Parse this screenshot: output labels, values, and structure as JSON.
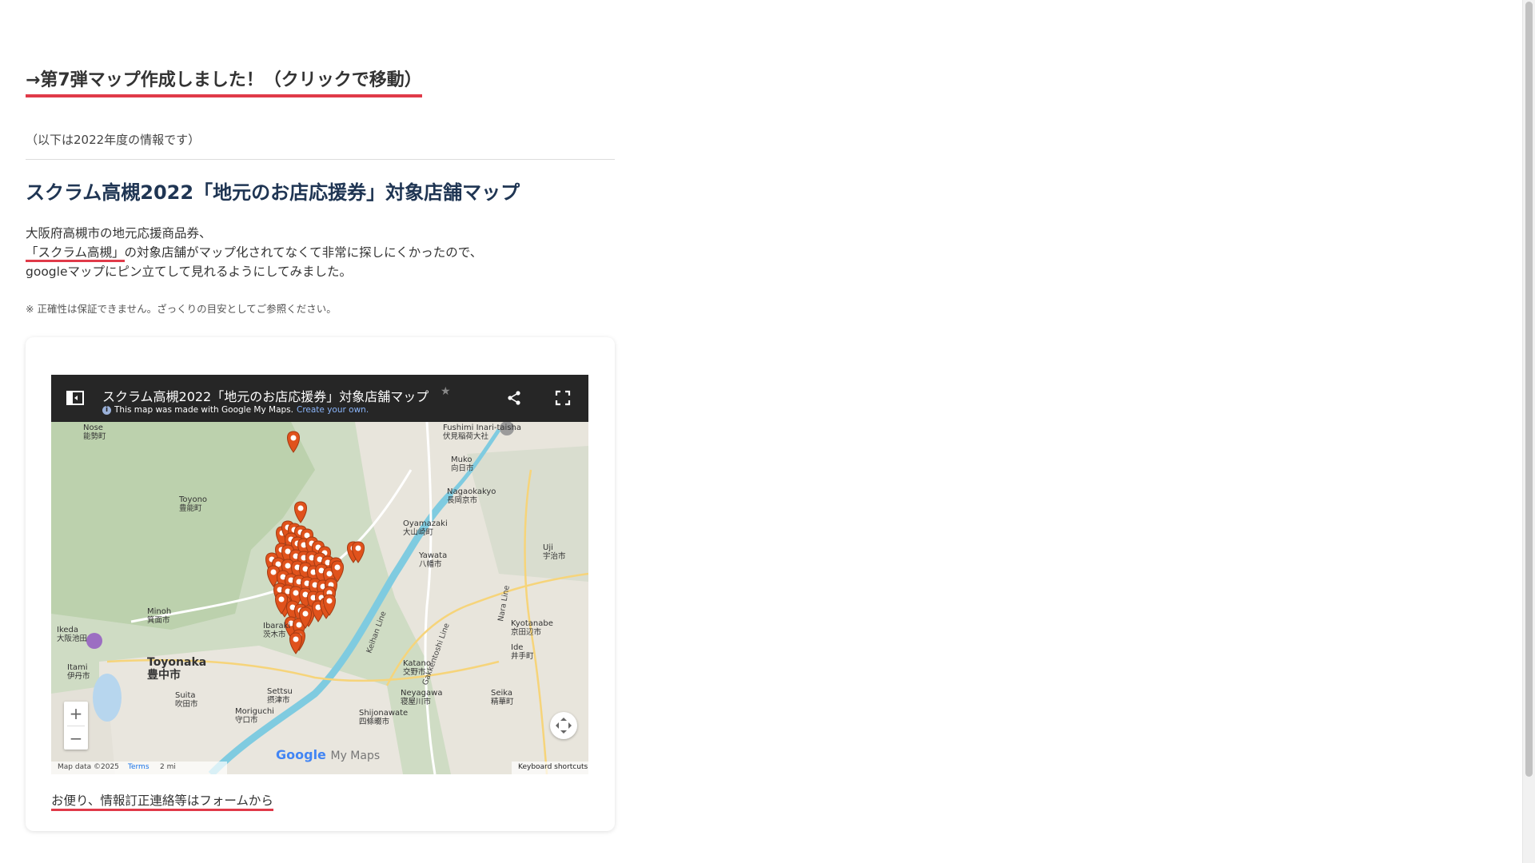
{
  "top_link": "→第7弾マップ作成しました！（クリックで移動）",
  "note_year": "（以下は2022年度の情報です）",
  "page_title": "スクラム高槻2022「地元のお店応援券」対象店舗マップ",
  "description": {
    "line1": "大阪府高槻市の地元応援商品券、",
    "line2_link": "「スクラム高槻」",
    "line2_rest": "の対象店舗がマップ化されてなくて非常に探しにくかったので、",
    "line3": "googleマップにピン立てして見れるようにしてみました。"
  },
  "disclaimer": "※ 正確性は保証できません。ざっくりの目安としてご参照ください。",
  "map": {
    "title": "スクラム高槻2022「地元のお店応援券」対象店舗マップ",
    "made_with": "This map was made with Google My Maps.",
    "create_link": "Create your own.",
    "google_logo": "Google",
    "my_maps": "My Maps",
    "map_data": "Map data ©2025",
    "terms": "Terms",
    "scale": "2 mi",
    "keyboard": "Keyboard shortcuts",
    "zoom_in": "+",
    "zoom_out": "−",
    "places": [
      {
        "name": "Nose",
        "kanji": "能勢町"
      },
      {
        "name": "Fushimi Inari-taisha",
        "kanji": "伏見稲荷大社"
      },
      {
        "name": "Muko",
        "kanji": "向日市"
      },
      {
        "name": "Nagaokakyo",
        "kanji": "長岡京市"
      },
      {
        "name": "Toyono",
        "kanji": "豊能町"
      },
      {
        "name": "Oyamazaki",
        "kanji": "大山崎町"
      },
      {
        "name": "Uji",
        "kanji": "宇治市"
      },
      {
        "name": "Yawata",
        "kanji": "八幡市"
      },
      {
        "name": "Minoh",
        "kanji": "箕面市"
      },
      {
        "name": "Ibaraki",
        "kanji": "茨木市"
      },
      {
        "name": "Kyotanabe",
        "kanji": "京田辺市"
      },
      {
        "name": "Toyonaka",
        "kanji": "豊中市"
      },
      {
        "name": "Settsu",
        "kanji": "摂津市"
      },
      {
        "name": "Katano",
        "kanji": "交野市"
      },
      {
        "name": "Ide",
        "kanji": "井手町"
      },
      {
        "name": "Itami",
        "kanji": "伊丹市"
      },
      {
        "name": "Suita",
        "kanji": "吹田市"
      },
      {
        "name": "Neyagawa",
        "kanji": "寝屋川市"
      },
      {
        "name": "Seika",
        "kanji": "精華町"
      },
      {
        "name": "Moriguchi",
        "kanji": "守口市"
      },
      {
        "name": "Shijonawate",
        "kanji": "四條畷市"
      },
      {
        "name": "Ikeda",
        "kanji": "大阪池田"
      }
    ],
    "line_labels": [
      "Keihan Line",
      "Gakkentoshi Line",
      "Nara Line"
    ]
  },
  "footer_link": "お便り、情報訂正連絡等はフォームから",
  "colors": {
    "accent_underline": "#e03a49",
    "title": "#1f3553",
    "pin": "#e0521c"
  }
}
